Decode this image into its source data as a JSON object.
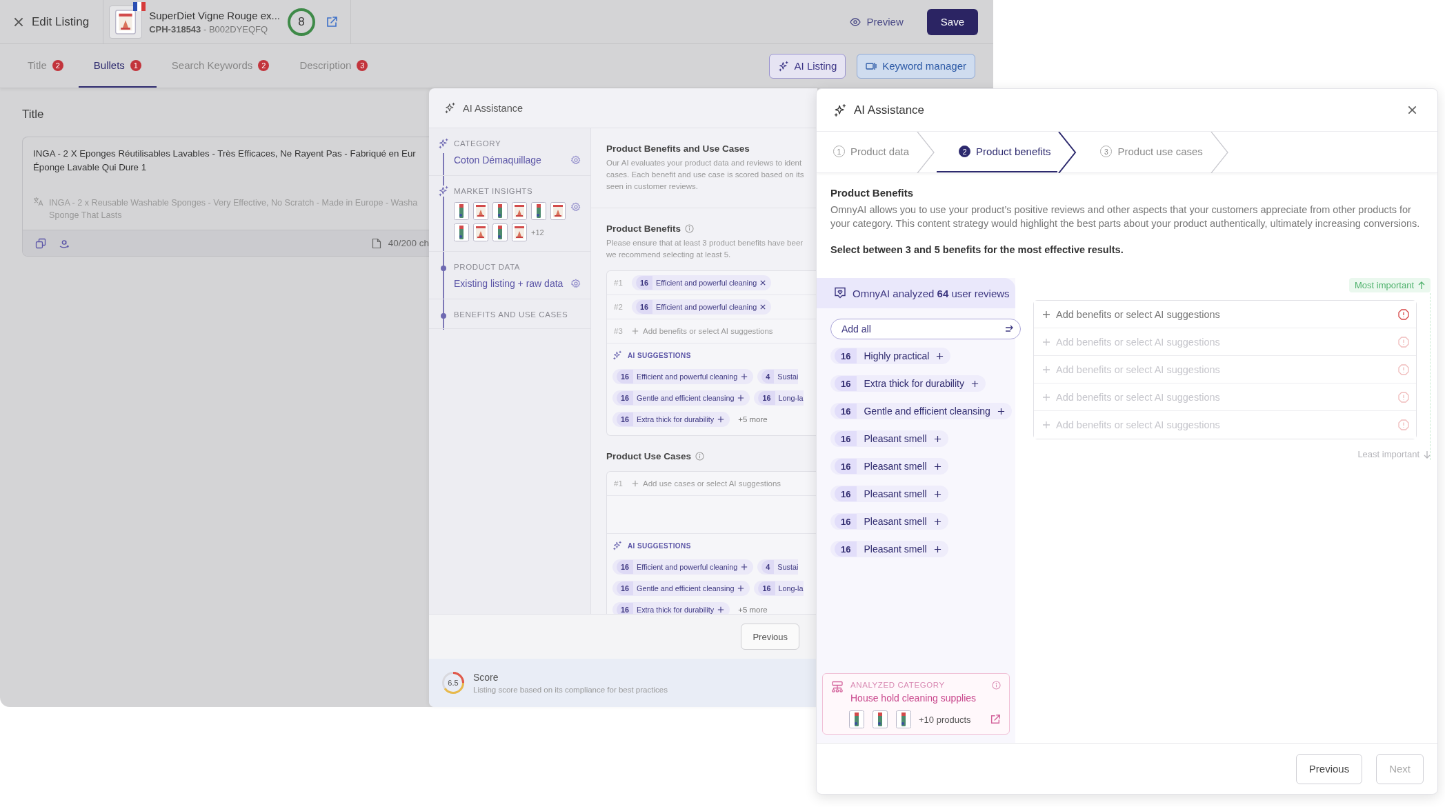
{
  "top_bar": {
    "title": "Edit Listing",
    "product": {
      "name": "SuperDiet Vigne Rouge ex...",
      "code": "**CPH-318543** - B002DYEQFQ",
      "score": "8"
    },
    "preview": "Preview",
    "save": "Save"
  },
  "tabs": [
    {
      "label": "Title",
      "count": "2",
      "selected": false
    },
    {
      "label": "Bullets",
      "count": "1",
      "selected": true
    },
    {
      "label": "Search Keywords",
      "count": "2",
      "selected": false
    },
    {
      "label": "Description",
      "count": "3",
      "selected": false
    }
  ],
  "tool_buttons": [
    {
      "label": "AI Listing",
      "kind": "ai"
    },
    {
      "label": "Keyword manager",
      "kind": "keyword"
    }
  ],
  "editor": {
    "heading": "Title",
    "lines": [
      "INGA - 2 X Eponges Réutilisables Lavables - Très Efficaces, Ne Rayent Pas - Fabriqué en Eur",
      "Éponge Lavable Qui Dure 1"
    ],
    "translation": [
      "INGA - 2 x Reusable Washable Sponges - Very Effective, No Scratch - Made in Europe - Washa",
      "Sponge That Lasts"
    ],
    "counter": "40/200 ch"
  },
  "assistant": {
    "title": "AI Assistance",
    "steps": [
      {
        "kind": "sparkle",
        "label": "CATEGORY",
        "value": "Coton Démaquillage"
      },
      {
        "kind": "sparkle",
        "label": "MARKET INSIGHTS",
        "more": "+12"
      },
      {
        "kind": "dot",
        "label": "PRODUCT DATA",
        "value": "Existing listing + raw data"
      },
      {
        "kind": "dot",
        "label": "BENEFITS AND USE CASES"
      }
    ],
    "intro": {
      "title": "Product Benefits and Use Cases",
      "lines": [
        "Our AI evaluates your product data and reviews to ident",
        "cases. Each benefit and use case is scored based on its",
        "seen in customer reviews."
      ]
    },
    "sections": [
      {
        "title": "Product Benefits",
        "lines": [
          "Please ensure that at least 3 product benefits have beer",
          "we recommend selecting at least 5."
        ],
        "rows": [
          {
            "rank": "#1",
            "score": "16",
            "label": "Efficient and powerful cleaning"
          },
          {
            "rank": "#2",
            "score": "16",
            "label": "Efficient and powerful cleaning"
          },
          {
            "rank": "#3",
            "placeholder": "Add benefits or select AI suggestions"
          }
        ],
        "suggestions_title": "AI SUGGESTIONS",
        "suggestions": [
          [
            {
              "score": "16",
              "label": "Efficient and powerful cleaning",
              "kind": "add"
            },
            {
              "score": "4",
              "label": "Sustai",
              "kind": "partial"
            }
          ],
          [
            {
              "score": "16",
              "label": "Gentle and efficient cleansing",
              "kind": "add"
            },
            {
              "score": "16",
              "label": "Long-la",
              "kind": "partial"
            }
          ],
          [
            {
              "score": "16",
              "label": "Extra thick for durability",
              "kind": "add"
            }
          ]
        ],
        "more": "+5 more"
      },
      {
        "title": "Product Use Cases",
        "rows": [
          {
            "rank": "#1",
            "placeholder": "Add use cases or select AI suggestions"
          }
        ],
        "suggestions_title": "AI SUGGESTIONS",
        "suggestions": [
          [
            {
              "score": "16",
              "label": "Efficient and powerful cleaning",
              "kind": "add"
            },
            {
              "score": "4",
              "label": "Sustai",
              "kind": "partial"
            }
          ],
          [
            {
              "score": "16",
              "label": "Gentle and efficient cleansing",
              "kind": "add"
            },
            {
              "score": "16",
              "label": "Long-la",
              "kind": "partial"
            }
          ],
          [
            {
              "score": "16",
              "label": "Extra thick for durability",
              "kind": "add"
            }
          ]
        ],
        "more": "+5 more"
      }
    ],
    "previous": "Previous",
    "score": {
      "value": "6.5",
      "level": 0.65,
      "title": "Score",
      "description": "Listing score based on its compliance for best practices"
    }
  },
  "dialog": {
    "title": "AI Assistance",
    "steps": [
      {
        "number": "1",
        "label": "Product data",
        "selected": false
      },
      {
        "number": "2",
        "label": "Product benefits",
        "selected": true
      },
      {
        "number": "3",
        "label": "Product use cases",
        "selected": false
      }
    ],
    "heading": "Product Benefits",
    "description": "OmnyAI allows you to use your product’s positive reviews and other aspects that your customers appreciate from other products for your category. This content strategy would highlight the best parts about your product authentically, ultimately increasing conversions.",
    "instruction": "Select between 3 and 5 benefits for the most effective results.",
    "reviews_summary": "OmnyAI analyzed **64** user reviews",
    "add_all": "Add all",
    "benefits": [
      {
        "score": "16",
        "label": "Highly practical"
      },
      {
        "score": "16",
        "label": "Extra thick for durability"
      },
      {
        "score": "16",
        "label": "Gentle and efficient cleansing"
      },
      {
        "score": "16",
        "label": "Pleasant smell"
      },
      {
        "score": "16",
        "label": "Pleasant smell"
      },
      {
        "score": "16",
        "label": "Pleasant smell"
      },
      {
        "score": "16",
        "label": "Pleasant smell"
      },
      {
        "score": "16",
        "label": "Pleasant smell"
      }
    ],
    "category": {
      "label": "ANALYZED CATEGORY",
      "name": "House hold cleaning supplies",
      "more": "+10 products"
    },
    "most_important": "Most important",
    "least_important": "Least important",
    "slots": [
      {
        "placeholder": "Add benefits or select AI suggestions",
        "disabled": false
      },
      {
        "placeholder": "Add benefits or select AI suggestions",
        "disabled": true
      },
      {
        "placeholder": "Add benefits or select AI suggestions",
        "disabled": true
      },
      {
        "placeholder": "Add benefits or select AI suggestions",
        "disabled": true
      },
      {
        "placeholder": "Add benefits or select AI suggestions",
        "disabled": true
      }
    ],
    "buttons": [
      {
        "label": "Previous",
        "disabled": false
      },
      {
        "label": "Next",
        "disabled": true
      }
    ]
  }
}
